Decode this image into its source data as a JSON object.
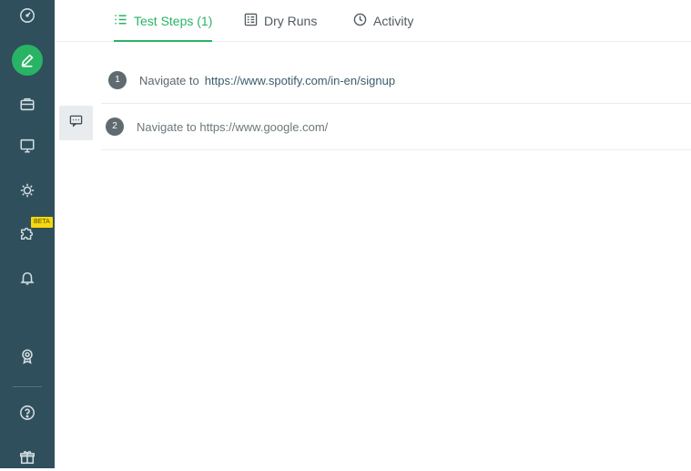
{
  "sidebar": {
    "items": [
      {
        "icon": "dashboard-gauge-icon"
      },
      {
        "icon": "pencil-edit-icon",
        "active": true
      },
      {
        "icon": "briefcase-icon"
      },
      {
        "icon": "monitor-icon"
      },
      {
        "icon": "gear-bug-icon"
      },
      {
        "icon": "puzzle-icon",
        "badge": "BETA"
      },
      {
        "icon": "bell-icon"
      },
      {
        "icon": "award-badge-icon"
      },
      {
        "icon": "help-question-icon"
      },
      {
        "icon": "gift-icon"
      }
    ],
    "beta_label": "BETA"
  },
  "tabs": [
    {
      "label": "Test Steps (1)",
      "icon": "list-icon",
      "active": true
    },
    {
      "label": "Dry Runs",
      "icon": "report-list-icon"
    },
    {
      "label": "Activity",
      "icon": "clock-icon"
    }
  ],
  "steps": [
    {
      "number": "1",
      "text": "Navigate to",
      "link": "https://www.spotify.com/in-en/signup"
    },
    {
      "number": "2",
      "text": "Navigate to https://www.google.com/"
    }
  ],
  "colors": {
    "sidebar_bg": "#2f4f5c",
    "accent": "#29b365",
    "beta_badge": "#f5d80f"
  }
}
